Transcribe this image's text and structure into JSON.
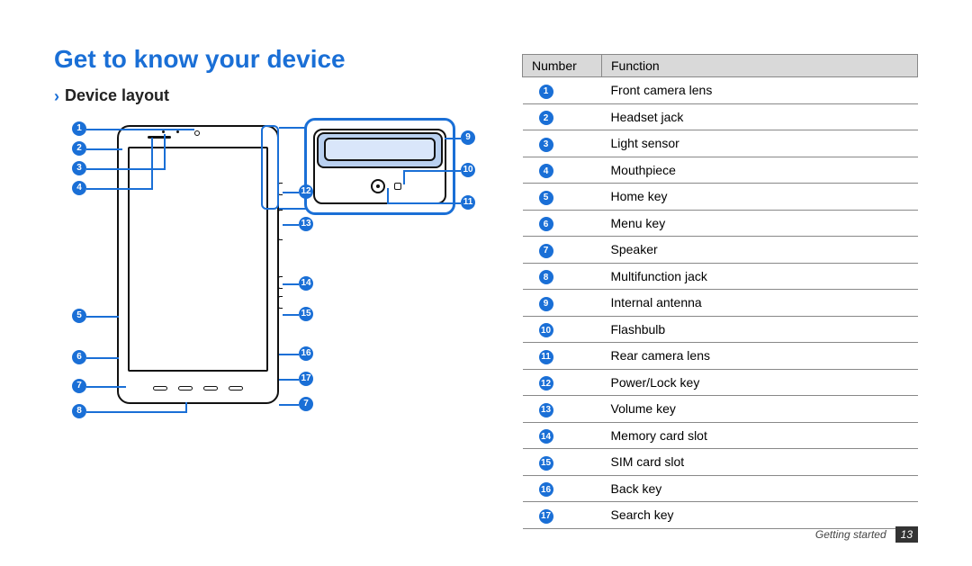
{
  "title": "Get to know your device",
  "subtitle": "Device layout",
  "table": {
    "headers": {
      "number": "Number",
      "function": "Function"
    },
    "rows": [
      {
        "n": "1",
        "f": "Front camera lens"
      },
      {
        "n": "2",
        "f": "Headset jack"
      },
      {
        "n": "3",
        "f": "Light sensor"
      },
      {
        "n": "4",
        "f": "Mouthpiece"
      },
      {
        "n": "5",
        "f": "Home key"
      },
      {
        "n": "6",
        "f": "Menu key"
      },
      {
        "n": "7",
        "f": "Speaker"
      },
      {
        "n": "8",
        "f": "Multifunction jack"
      },
      {
        "n": "9",
        "f": "Internal antenna"
      },
      {
        "n": "10",
        "f": "Flashbulb"
      },
      {
        "n": "11",
        "f": "Rear camera lens"
      },
      {
        "n": "12",
        "f": "Power/Lock key"
      },
      {
        "n": "13",
        "f": "Volume key"
      },
      {
        "n": "14",
        "f": "Memory card slot"
      },
      {
        "n": "15",
        "f": "SIM card slot"
      },
      {
        "n": "16",
        "f": "Back key"
      },
      {
        "n": "17",
        "f": "Search key"
      }
    ]
  },
  "callouts": {
    "c1": "1",
    "c2": "2",
    "c3": "3",
    "c4": "4",
    "c5": "5",
    "c6": "6",
    "c7": "7",
    "c7b": "7",
    "c8": "8",
    "c9": "9",
    "c10": "10",
    "c11": "11",
    "c12": "12",
    "c13": "13",
    "c14": "14",
    "c15": "15",
    "c16": "16",
    "c17": "17"
  },
  "footer": {
    "section": "Getting started",
    "page": "13"
  }
}
